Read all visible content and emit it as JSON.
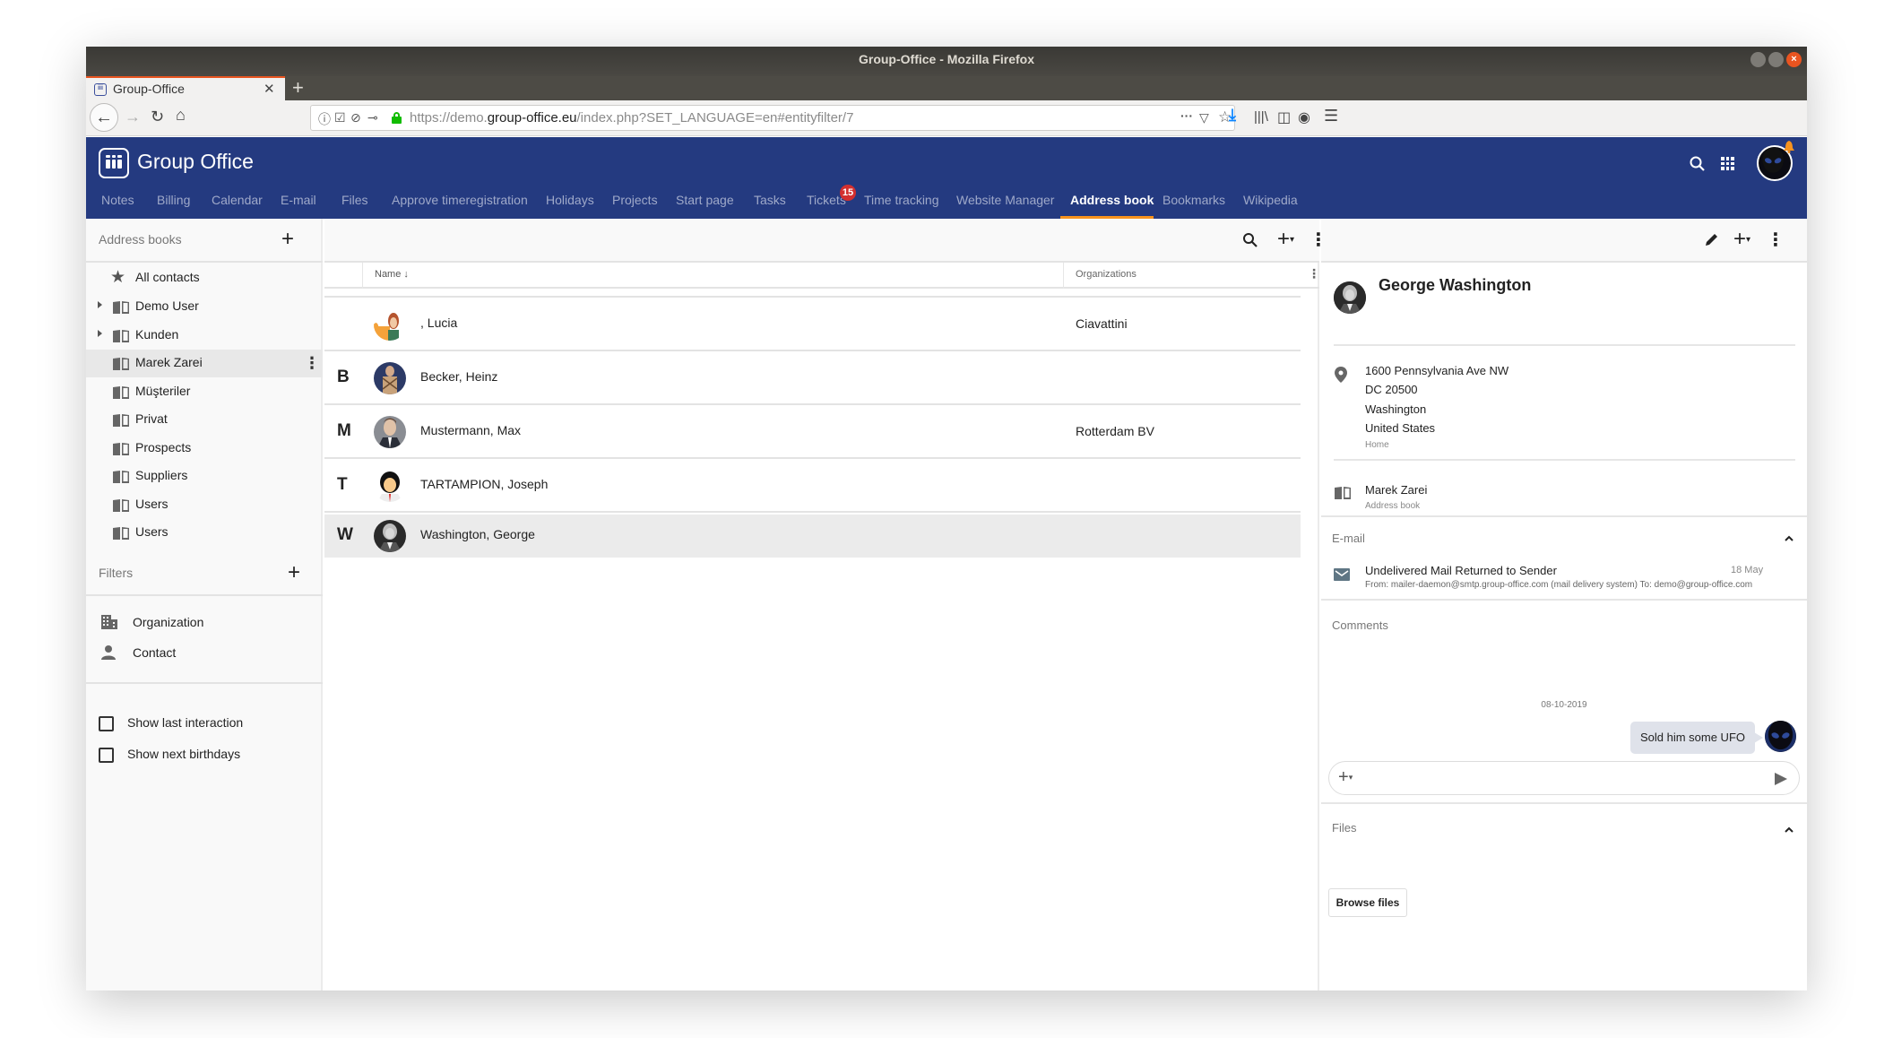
{
  "window": {
    "title": "Group-Office - Mozilla Firefox",
    "controls": [
      "minimize",
      "maximize",
      "close"
    ]
  },
  "browser": {
    "tab_title": "Group-Office",
    "url_host_prefix": "https://demo.",
    "url_host": "group-office.eu",
    "url_path": "/index.php?SET_LANGUAGE=en#entityfilter/7"
  },
  "app": {
    "title": "Group Office",
    "modules": [
      {
        "label": "Notes"
      },
      {
        "label": "Billing"
      },
      {
        "label": "Calendar"
      },
      {
        "label": "E-mail"
      },
      {
        "label": "Files"
      },
      {
        "label": "Approve timeregistration"
      },
      {
        "label": "Holidays"
      },
      {
        "label": "Projects"
      },
      {
        "label": "Start page"
      },
      {
        "label": "Tasks"
      },
      {
        "label": "Tickets",
        "badge": "15"
      },
      {
        "label": "Time tracking"
      },
      {
        "label": "Website Manager"
      },
      {
        "label": "Address book",
        "active": true
      },
      {
        "label": "Bookmarks"
      },
      {
        "label": "Wikipedia"
      }
    ],
    "accent_color": "#f7931e",
    "header_color": "#243a80",
    "badge_color": "#d32f2f"
  },
  "sidebar": {
    "address_books_label": "Address books",
    "address_books": [
      {
        "label": "All contacts",
        "icon": "star-icon"
      },
      {
        "label": "Demo User",
        "expandable": true
      },
      {
        "label": "Kunden",
        "expandable": true
      },
      {
        "label": "Marek Zarei",
        "selected": true
      },
      {
        "label": "Müşteriler"
      },
      {
        "label": "Privat"
      },
      {
        "label": "Prospects"
      },
      {
        "label": "Suppliers"
      },
      {
        "label": "Users"
      },
      {
        "label": "Users"
      }
    ],
    "filters_label": "Filters",
    "filters": [
      {
        "label": "Organization",
        "icon": "building-icon"
      },
      {
        "label": "Contact",
        "icon": "person-icon"
      }
    ],
    "options": [
      {
        "label": "Show last interaction",
        "checked": false
      },
      {
        "label": "Show next birthdays",
        "checked": false
      }
    ]
  },
  "list": {
    "columns": {
      "name": "Name ↓",
      "organizations": "Organizations"
    },
    "rows": [
      {
        "letter": "",
        "name": ", Lucia",
        "organization": "Ciavattini",
        "avatar": "lucia"
      },
      {
        "letter": "B",
        "name": "Becker, Heinz",
        "organization": "",
        "avatar": "heinz"
      },
      {
        "letter": "M",
        "name": "Mustermann, Max",
        "organization": "Rotterdam BV",
        "avatar": "max"
      },
      {
        "letter": "T",
        "name": "TARTAMPION, Joseph",
        "organization": "",
        "avatar": "joseph"
      },
      {
        "letter": "W",
        "name": "Washington, George",
        "organization": "",
        "avatar": "george",
        "selected": true
      }
    ]
  },
  "detail": {
    "name": "George Washington",
    "address": {
      "lines": [
        "1600 Pennsylvania Ave NW",
        "DC 20500",
        "Washington",
        "United States"
      ],
      "type": "Home"
    },
    "address_book": {
      "value": "Marek Zarei",
      "label": "Address book"
    },
    "email_section": {
      "title": "E-mail",
      "items": [
        {
          "subject": "Undelivered Mail Returned to Sender",
          "date": "18 May",
          "from": "From: mailer-daemon@smtp.group-office.com (mail delivery system) To: demo@group-office.com"
        }
      ]
    },
    "comments_section": {
      "title": "Comments",
      "date": "08-10-2019",
      "comments": [
        {
          "text": "Sold him some UFO"
        }
      ],
      "input_placeholder": ""
    },
    "files_section": {
      "title": "Files",
      "browse_label": "Browse files"
    }
  }
}
